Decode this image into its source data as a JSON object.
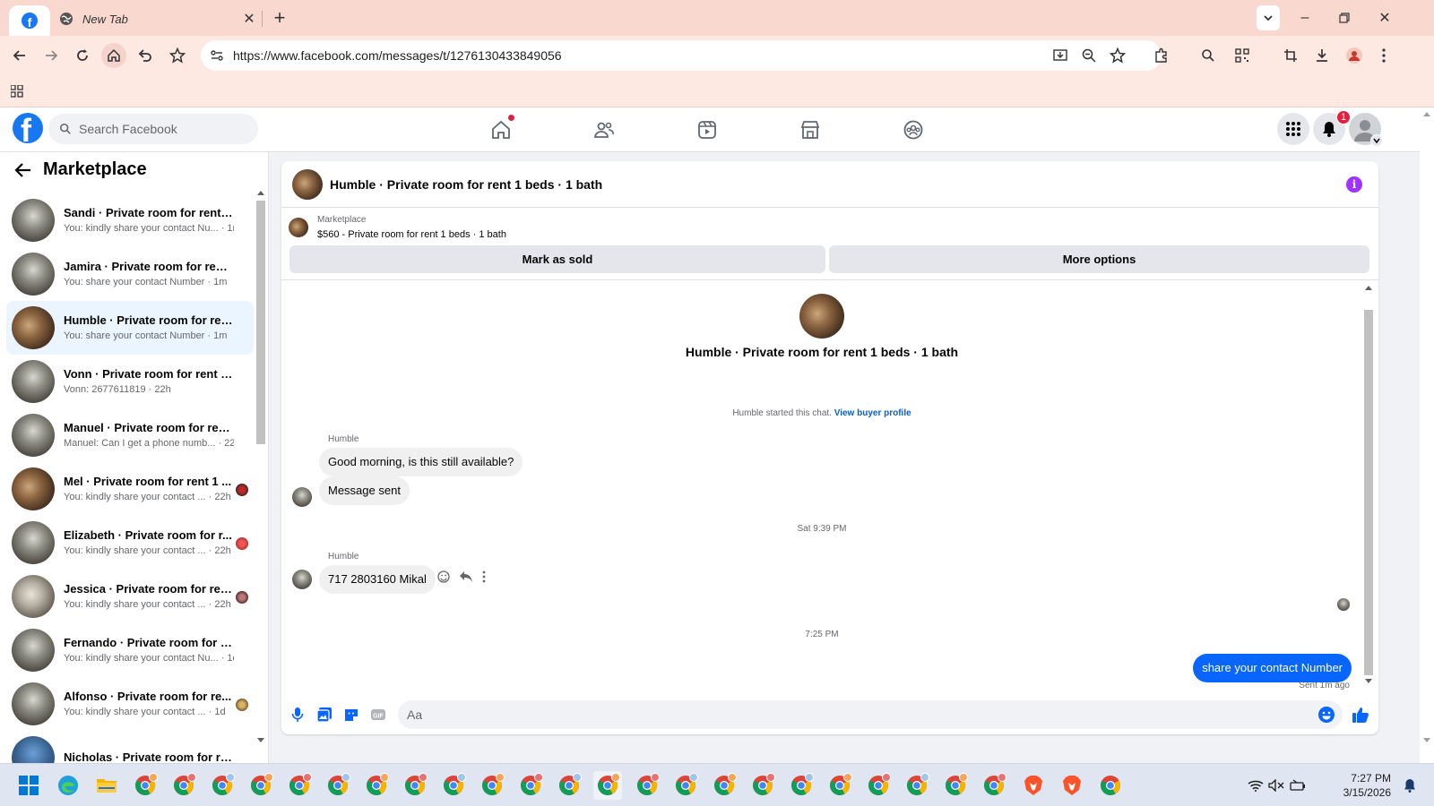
{
  "browser": {
    "tabs": [
      {
        "title": "",
        "active": true,
        "favicon": "facebook-icon"
      },
      {
        "title": "New Tab",
        "active": false,
        "favicon": "globe-icon"
      }
    ],
    "url": "https://www.facebook.com/messages/t/1276130433849056"
  },
  "fb": {
    "search_placeholder": "Search Facebook",
    "notifications_count": "1",
    "nav_icons": [
      "home-icon",
      "friends-icon",
      "video-icon",
      "marketplace-icon",
      "groups-icon"
    ]
  },
  "sidebar": {
    "title": "Marketplace",
    "conversations": [
      {
        "name": "Sandi · Private room for rent 1 ...",
        "snippet": "You: kindly share your contact Nu... · 1m"
      },
      {
        "name": "Jamira · Private room for rent 1 ...",
        "snippet": "You: share your contact Number · 1m"
      },
      {
        "name": "Humble · Private room for rent ...",
        "snippet": "You: share your contact Number · 1m"
      },
      {
        "name": "Vonn · Private room for rent 1 b...",
        "snippet": "Vonn: 2677611819 · 22h"
      },
      {
        "name": "Manuel · Private room for rent ...",
        "snippet": "Manuel: Can I get a phone numb... · 22h"
      },
      {
        "name": "Mel · Private room for rent 1 ...",
        "snippet": "You: kindly share your contact ... · 22h"
      },
      {
        "name": "Elizabeth · Private room for r...",
        "snippet": "You: kindly share your contact ... · 22h"
      },
      {
        "name": "Jessica · Private room for ren...",
        "snippet": "You: kindly share your contact ... · 22h"
      },
      {
        "name": "Fernando · Private room for ren...",
        "snippet": "You: kindly share your contact Nu... · 1d"
      },
      {
        "name": "Alfonso · Private room for re...",
        "snippet": "You: kindly share your contact ... · 1d"
      },
      {
        "name": "Nicholas · Private room for rent...",
        "snippet": ""
      }
    ]
  },
  "chat": {
    "header_title": "Humble · Private room for rent 1 beds · 1 bath",
    "listing_label": "Marketplace",
    "listing_desc": "$560 - Private room for rent 1 beds · 1 bath",
    "mark_sold": "Mark as sold",
    "more_options": "More options",
    "center_title": "Humble · Private room for rent 1 beds · 1 bath",
    "started_text": "Humble started this chat.",
    "view_profile": "View buyer profile",
    "sender1": "Humble",
    "msg1": "Good morning, is this still available?",
    "msg2": "Message sent",
    "time1": "Sat 9:39 PM",
    "sender2": "Humble",
    "msg3": "717 2803160 Mikal",
    "time2": "7:25 PM",
    "msg_out": "share your contact Number",
    "sent_status": "Sent 1m ago",
    "composer_placeholder": "Aa"
  },
  "taskbar": {
    "time": "7:27 PM",
    "date": "3/15/2026"
  },
  "colors": {
    "fb_blue": "#1877f2",
    "messenger_blue": "#0866ff",
    "tab_bar": "#f9d9cf"
  }
}
